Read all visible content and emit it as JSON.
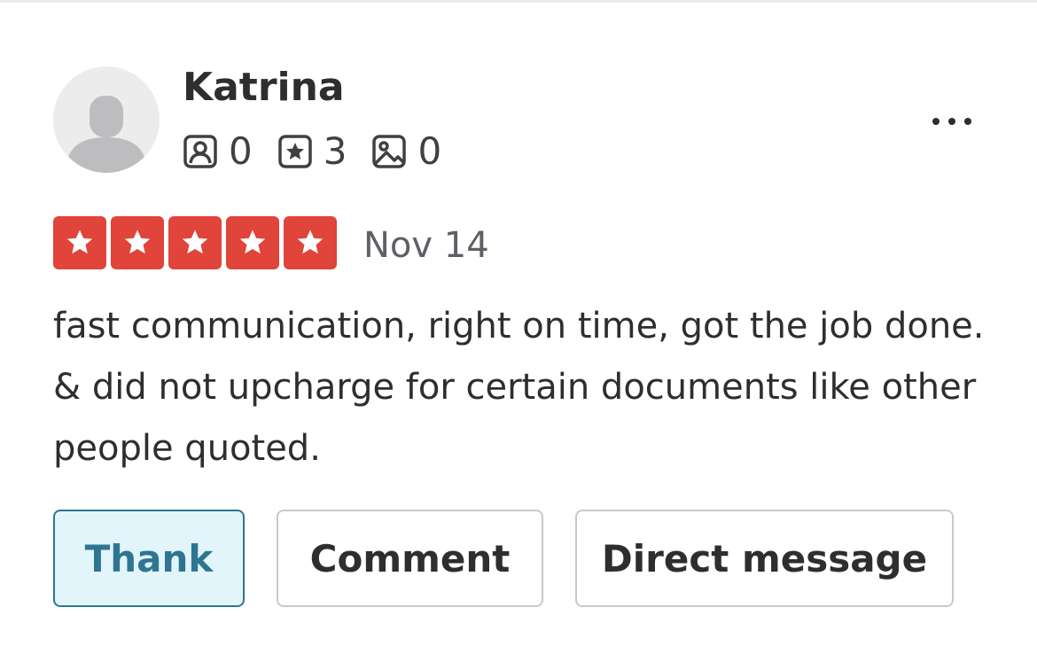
{
  "reviewer": {
    "name": "Katrina",
    "stats": [
      {
        "icon": "friends-icon",
        "count": "0"
      },
      {
        "icon": "review-star-icon",
        "count": "3"
      },
      {
        "icon": "photo-icon",
        "count": "0"
      }
    ]
  },
  "review": {
    "rating": 5,
    "date": "Nov 14",
    "text": "fast communication, right on time, got the job done. & did not upcharge for certain documents like other people quoted."
  },
  "actions": {
    "thank_label": "Thank",
    "comment_label": "Comment",
    "direct_message_label": "Direct message"
  },
  "colors": {
    "star_red": "#e0443a",
    "thank_accent": "#2f7591",
    "thank_background": "#e2f5fb"
  }
}
